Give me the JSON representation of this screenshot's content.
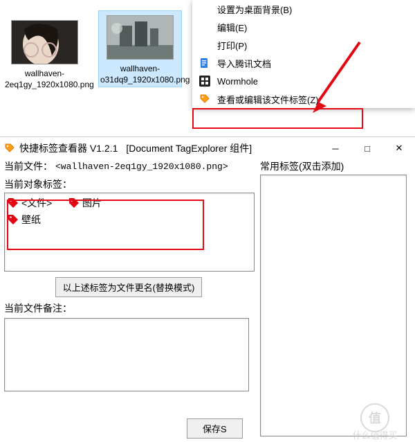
{
  "explorer": {
    "files": [
      {
        "label": "wallhaven-2eq1gy_1920x1080.png"
      },
      {
        "label": "wallhaven-o31dq9_1920x1080.png"
      }
    ]
  },
  "context_menu": {
    "items": [
      {
        "label": "设置为桌面背景(B)"
      },
      {
        "label": "编辑(E)"
      },
      {
        "label": "打印(P)"
      },
      {
        "label": "导入腾讯文档"
      },
      {
        "label": "Wormhole"
      },
      {
        "label": "查看或编辑该文件标签(Z)"
      }
    ]
  },
  "window": {
    "title": "快捷标签查看器 V1.2.1",
    "subtitle": "[Document TagExplorer 组件]",
    "current_file_label": "当前文件：",
    "current_file_value": "<wallhaven-2eq1gy_1920x1080.png>",
    "current_tags_label": "当前对象标签：",
    "tags": [
      "<文件>",
      "图片",
      "壁纸"
    ],
    "rename_button": "以上述标签为文件更名(替换模式)",
    "current_note_label": "当前文件备注：",
    "save_button": "保存S",
    "common_tags_label": "常用标签(双击添加)"
  },
  "watermark": {
    "line1": "值",
    "line2": "什么值得买"
  }
}
